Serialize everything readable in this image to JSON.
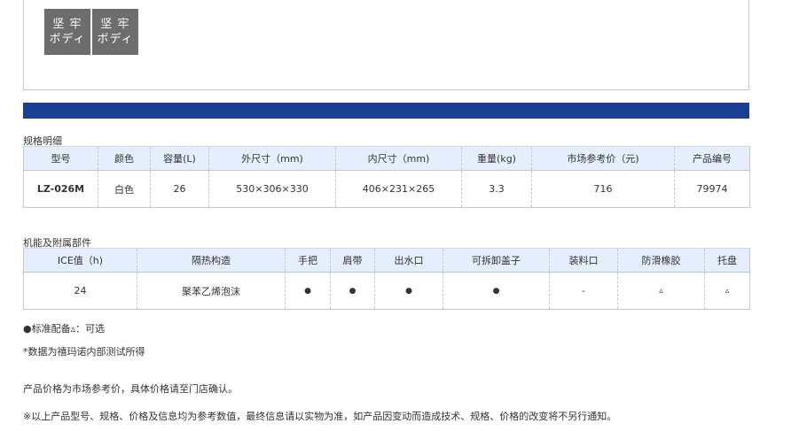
{
  "badge_image": {
    "tiles": [
      {
        "line1": "坚 牢",
        "line2": "ボディ"
      },
      {
        "line1": "坚 牢",
        "line2": "ボディ"
      }
    ]
  },
  "colors": {
    "accent_bar": "#1c3f94",
    "header_bg": "#e4eefc",
    "badge_bg": "#6d6d6d"
  },
  "spec": {
    "title": "规格明细",
    "headers": [
      "型号",
      "颜色",
      "容量(L)",
      "外尺寸（mm)",
      "内尺寸（mm)",
      "重量(kg)",
      "市场参考价（元)",
      "产品编号"
    ],
    "row": [
      "LZ-026M",
      "白色",
      "26",
      "530×306×330",
      "406×231×265",
      "3.3",
      "716",
      "79974"
    ]
  },
  "features": {
    "title": "机能及附属部件",
    "headers": [
      "ICE值（h)",
      "隔热构造",
      "手把",
      "肩带",
      "出水口",
      "可拆卸盖子",
      "装料口",
      "防滑橡胶",
      "托盘"
    ],
    "row": [
      "24",
      "聚苯乙烯泡沫",
      "●",
      "●",
      "●",
      "●",
      "-",
      "▵",
      "▵"
    ]
  },
  "notes": {
    "legend": "●标准配备▵：可选",
    "data_source": "*数据为禧玛诺内部测试所得",
    "price_note": "产品价格为市场参考价，具体价格请至门店确认。",
    "disclaimer": "※以上产品型号、规格、价格及信息均为参考数值，最终信息请以实物为准，如产品因变动而造成技术、规格、价格的改变将不另行通知。"
  }
}
